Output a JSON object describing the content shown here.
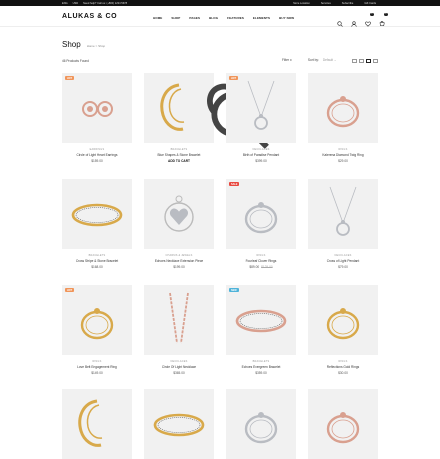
{
  "topbar": {
    "currency": "USD",
    "phone": "Need help? Call us: (+800) 1234 5678",
    "lang": "ENG",
    "links": [
      "Store Location",
      "Services",
      "Subscribe",
      "Gift Cards"
    ]
  },
  "header": {
    "logo": "ALUKAS & CO",
    "nav": [
      "HOME",
      "SHOP",
      "PAGES",
      "BLOG",
      "FEATURES",
      "ELEMENTS",
      "BUY NOW"
    ],
    "cart_count": "0",
    "wishlist_count": "0"
  },
  "page": {
    "title": "Shop",
    "breadcrumb": [
      "Home",
      "Shop"
    ],
    "products_found": "46 Products Found",
    "filter_label": "Filter",
    "sort_label": "Sort by:",
    "sort_value": "Default"
  },
  "colors": {
    "accent": "#f0955a",
    "sale": "#e8483f",
    "new": "#4fb3d9",
    "gold": "#d8a94a",
    "silver": "#b9bcc2",
    "rose": "#d9a08f"
  },
  "products": [
    {
      "category": "EARRINGS",
      "name": "Circle of Light Heart Earrings",
      "price": "$159.00",
      "tag": "HOT",
      "tag_color": "#f0955a",
      "metal": "rose",
      "kind": "earrings"
    },
    {
      "category": "BRACELETS",
      "name": "Blue Shapes & Stone Bracelet",
      "price": "",
      "cta": "ADD TO CART",
      "tag": "",
      "tag_color": "",
      "metal": "gold",
      "kind": "hoop"
    },
    {
      "category": "NECKLACES",
      "name": "Birth of Paradise Pendant",
      "price": "$399.00",
      "tag": "HOT",
      "tag_color": "#f0955a",
      "metal": "silver",
      "kind": "necklace"
    },
    {
      "category": "RINGS",
      "name": "Kalerena Diamond Twig Ring",
      "price": "$29.00",
      "tag": "",
      "tag_color": "",
      "metal": "rose",
      "kind": "ring"
    },
    {
      "category": "BRACELETS",
      "name": "Cross Stripe & Stone Bracelet",
      "price": "$168.00",
      "tag": "",
      "tag_color": "",
      "metal": "gold",
      "kind": "bangle"
    },
    {
      "category": "CHARMS & JEWELS",
      "name": "Echoes Necklace Extension Piece",
      "price": "$199.00",
      "tag": "",
      "tag_color": "",
      "metal": "silver",
      "kind": "charm"
    },
    {
      "category": "RINGS",
      "name": "Fourleaf Clover Rings",
      "price": "$89.00",
      "old_price": "$129.00",
      "tag": "SALE",
      "tag_color": "#e8483f",
      "metal": "silver",
      "kind": "ring"
    },
    {
      "category": "NECKLACES",
      "name": "Cross of Light Pendant",
      "price": "$79.00",
      "tag": "",
      "tag_color": "",
      "metal": "silver",
      "kind": "necklace"
    },
    {
      "category": "RINGS",
      "name": "Love Belt Engagement Ring",
      "price": "$149.00",
      "tag": "HOT",
      "tag_color": "#f0955a",
      "metal": "gold",
      "kind": "ring"
    },
    {
      "category": "NECKLACES",
      "name": "Circle Of Light Necklace",
      "price": "$365.00",
      "tag": "",
      "tag_color": "",
      "metal": "rose",
      "kind": "chain"
    },
    {
      "category": "BRACELETS",
      "name": "Echoes Evergreen Bracelet",
      "price": "$359.00",
      "tag": "NEW",
      "tag_color": "#4fb3d9",
      "metal": "rose",
      "kind": "bangle"
    },
    {
      "category": "RINGS",
      "name": "Reflections Gold Rings",
      "price": "$30.00",
      "tag": "",
      "tag_color": "",
      "metal": "gold",
      "kind": "ring"
    },
    {
      "category": "",
      "name": "",
      "price": "",
      "tag": "",
      "tag_color": "",
      "metal": "gold",
      "kind": "hoop"
    },
    {
      "category": "",
      "name": "",
      "price": "",
      "tag": "",
      "tag_color": "",
      "metal": "gold",
      "kind": "bangle"
    },
    {
      "category": "",
      "name": "",
      "price": "",
      "tag": "",
      "tag_color": "",
      "metal": "silver",
      "kind": "ring"
    },
    {
      "category": "",
      "name": "",
      "price": "",
      "tag": "",
      "tag_color": "",
      "metal": "rose",
      "kind": "ring"
    }
  ]
}
